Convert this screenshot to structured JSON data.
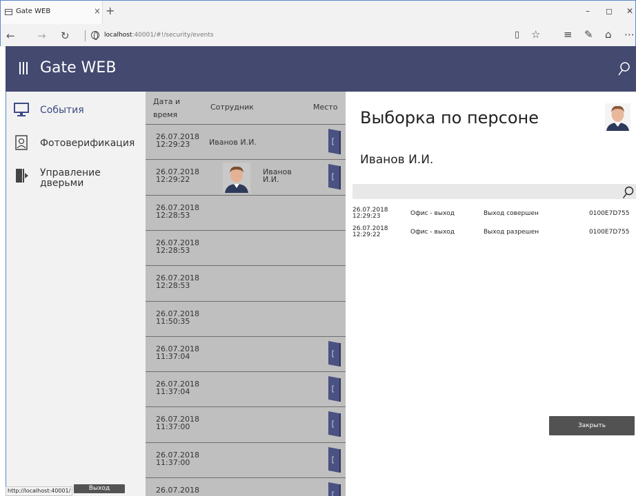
{
  "browser": {
    "tab_title": "Gate WEB",
    "tab_close": "×",
    "new_tab": "+",
    "url_host": "localhost",
    "url_rest": ":40001/#!/security/events",
    "controls": {
      "minimize": "–",
      "maximize": "◻",
      "close": "✕"
    }
  },
  "app": {
    "title": "Gate WEB"
  },
  "sidebar": {
    "items": [
      {
        "label": "События",
        "icon": "monitor-icon",
        "active": true
      },
      {
        "label": "Фотоверификация",
        "icon": "photo-verification-icon",
        "active": false
      },
      {
        "label": "Управление дверьми",
        "icon": "door-control-icon",
        "active": false
      }
    ]
  },
  "events": {
    "headers": {
      "date": "Дата и время",
      "employee": "Сотрудник",
      "place": "Место"
    },
    "rows": [
      {
        "date": "26.07.2018",
        "time": "12:29:23",
        "employee": "Иванов И.И.",
        "photo": false,
        "door": true
      },
      {
        "date": "26.07.2018",
        "time": "12:29:22",
        "employee": "Иванов И.И.",
        "photo": true,
        "door": true
      },
      {
        "date": "26.07.2018",
        "time": "12:28:53",
        "employee": "",
        "photo": false,
        "door": false
      },
      {
        "date": "26.07.2018",
        "time": "12:28:53",
        "employee": "",
        "photo": false,
        "door": false
      },
      {
        "date": "26.07.2018",
        "time": "12:28:53",
        "employee": "",
        "photo": false,
        "door": false
      },
      {
        "date": "26.07.2018",
        "time": "11:50:35",
        "employee": "",
        "photo": false,
        "door": false
      },
      {
        "date": "26.07.2018",
        "time": "11:37:04",
        "employee": "",
        "photo": false,
        "door": true
      },
      {
        "date": "26.07.2018",
        "time": "11:37:04",
        "employee": "",
        "photo": false,
        "door": true
      },
      {
        "date": "26.07.2018",
        "time": "11:37:00",
        "employee": "",
        "photo": false,
        "door": true
      },
      {
        "date": "26.07.2018",
        "time": "11:37:00",
        "employee": "",
        "photo": false,
        "door": true
      },
      {
        "date": "26.07.2018",
        "time": "",
        "employee": "",
        "photo": false,
        "door": true
      }
    ]
  },
  "panel": {
    "title": "Выборка по персоне",
    "person": "Иванов И.И.",
    "rows": [
      {
        "date": "26.07.2018",
        "time": "12:29:23",
        "place": "Офис - выход",
        "status": "Выход совершен",
        "card": "0100E7D755"
      },
      {
        "date": "26.07.2018",
        "time": "12:29:22",
        "place": "Офис - выход",
        "status": "Выход разрешен",
        "card": "0100E7D755"
      }
    ],
    "close_label": "Закрыть"
  },
  "statusbar": {
    "hover_url": "http://localhost:40001/",
    "logout_label": "Выход"
  },
  "colors": {
    "header_bg": "#43496f",
    "accent_blue": "#3b4a85",
    "door_color": "#4a5282"
  }
}
